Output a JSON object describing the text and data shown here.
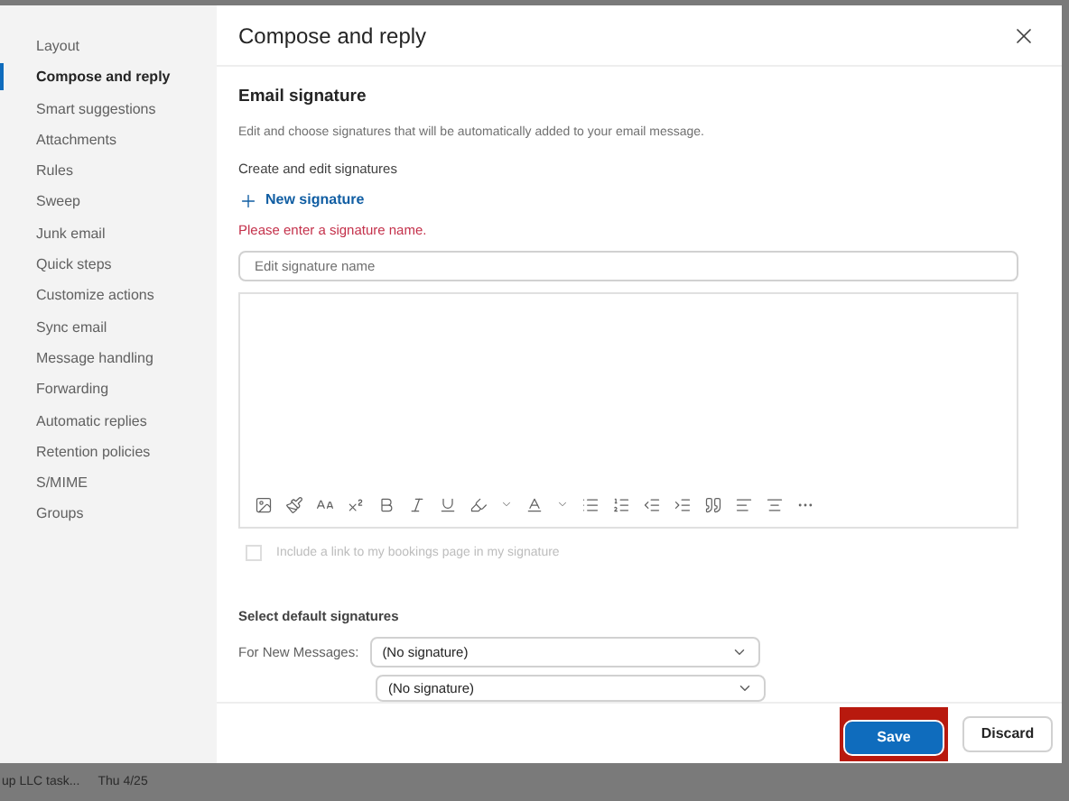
{
  "nav": {
    "items": [
      {
        "label": "Layout",
        "selected": false
      },
      {
        "label": "Compose and reply",
        "selected": true
      },
      {
        "label": "Smart suggestions",
        "selected": false
      },
      {
        "label": "Attachments",
        "selected": false
      },
      {
        "label": "Rules",
        "selected": false
      },
      {
        "label": "Sweep",
        "selected": false
      },
      {
        "label": "Junk email",
        "selected": false
      },
      {
        "label": "Quick steps",
        "selected": false
      },
      {
        "label": "Customize actions",
        "selected": false
      },
      {
        "label": "Sync email",
        "selected": false
      },
      {
        "label": "Message handling",
        "selected": false
      },
      {
        "label": "Forwarding",
        "selected": false
      },
      {
        "label": "Automatic replies",
        "selected": false
      },
      {
        "label": "Retention policies",
        "selected": false
      },
      {
        "label": "S/MIME",
        "selected": false
      },
      {
        "label": "Groups",
        "selected": false
      }
    ]
  },
  "dialog": {
    "title": "Compose and reply",
    "section_title": "Email signature",
    "description": "Edit and choose signatures that will be automatically added to your email message.",
    "subheading": "Create and edit signatures",
    "new_signature": "New signature",
    "error": "Please enter a signature name.",
    "name_field": {
      "placeholder": "Edit signature name"
    },
    "bookings_checkbox": {
      "label": "Include a link to my bookings page in my signature",
      "checked": false,
      "disabled": true
    },
    "defaults_heading": "Select default signatures",
    "new_messages_label": "For New Messages:",
    "new_messages_value": "(No signature)",
    "replies_value": "(No signature)"
  },
  "footer": {
    "save": {
      "label": "Save",
      "highlighted": true
    },
    "discard": "Discard"
  },
  "taskbar": {
    "task": "up LLC task...",
    "date": "Thu 4/25"
  }
}
